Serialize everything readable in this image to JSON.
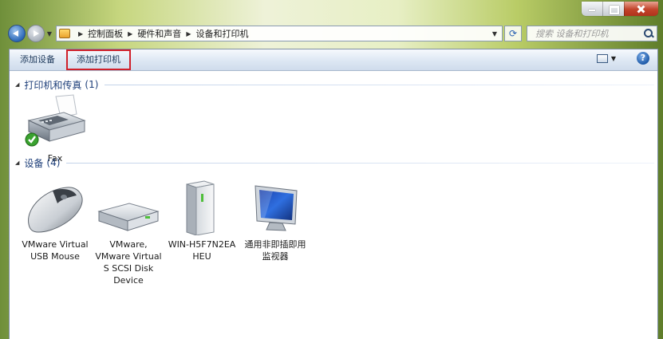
{
  "window": {
    "controls": [
      "minimize",
      "maximize",
      "close"
    ]
  },
  "address_bar": {
    "crumbs": [
      "控制面板",
      "硬件和声音",
      "设备和打印机"
    ],
    "search_placeholder": "搜索 设备和打印机"
  },
  "toolbar": {
    "add_device": "添加设备",
    "add_printer": "添加打印机",
    "help": "?"
  },
  "groups": [
    {
      "title": "打印机和传真",
      "count": "(1)",
      "items": [
        {
          "label": "Fax",
          "icon": "fax-printer-icon",
          "default": true
        }
      ]
    },
    {
      "title": "设备",
      "count": "(4)",
      "items": [
        {
          "label": "VMware Virtual\nUSB Mouse",
          "icon": "mouse-icon"
        },
        {
          "label": "VMware,\nVMware Virtual\nS SCSI Disk\nDevice",
          "icon": "disk-drive-icon"
        },
        {
          "label": "WIN-H5F7N2EA\nHEU",
          "icon": "computer-tower-icon"
        },
        {
          "label": "通用非即插即用\n监视器",
          "icon": "monitor-icon"
        }
      ]
    }
  ],
  "colors": {
    "highlight": "#d0202a",
    "group_text": "#1e3f7a",
    "toolbar_text": "#1e395b"
  }
}
